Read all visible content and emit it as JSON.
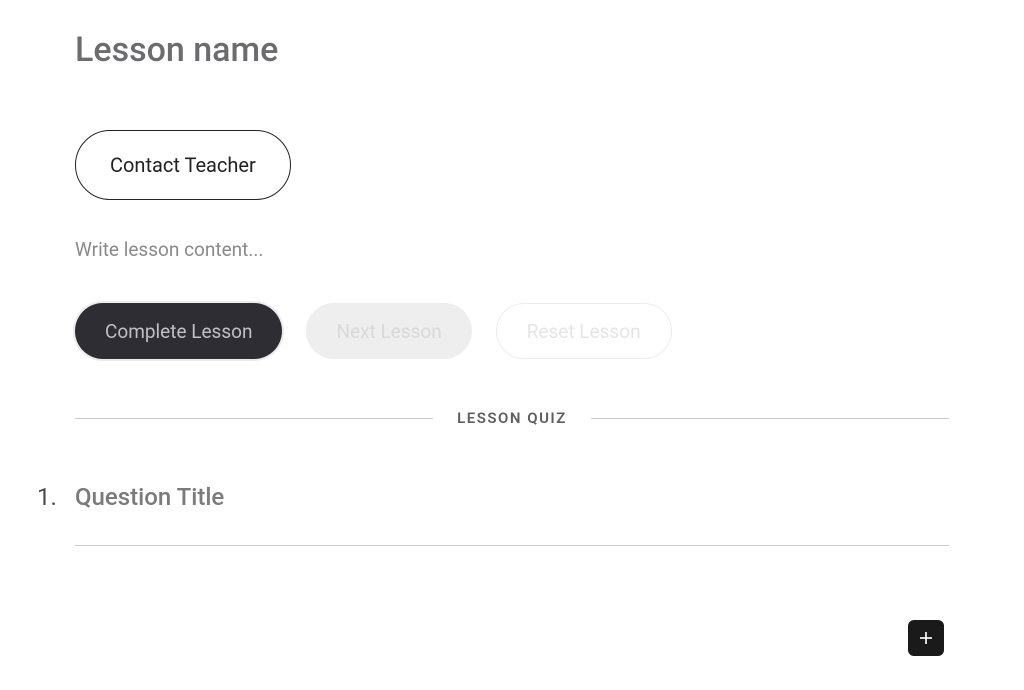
{
  "lesson": {
    "title_placeholder": "Lesson name",
    "contact_label": "Contact Teacher",
    "content_placeholder": "Write lesson content..."
  },
  "actions": {
    "complete_label": "Complete Lesson",
    "next_label": "Next Lesson",
    "reset_label": "Reset Lesson"
  },
  "quiz": {
    "section_label": "LESSON QUIZ",
    "questions": [
      {
        "number": "1.",
        "title_placeholder": "Question Title"
      }
    ]
  }
}
